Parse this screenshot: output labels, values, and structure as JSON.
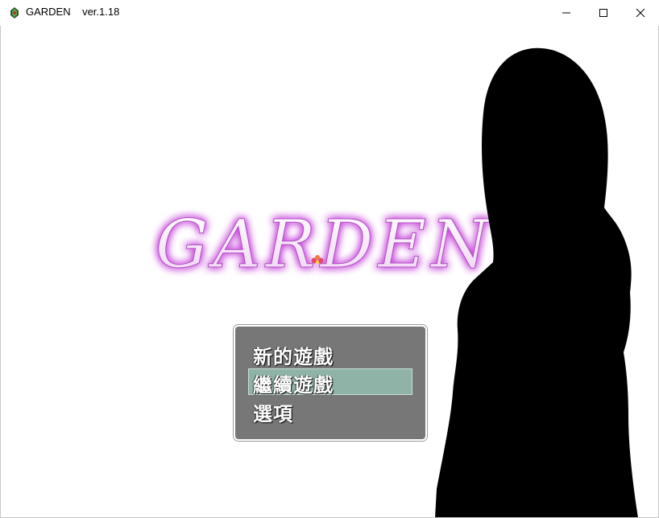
{
  "window": {
    "title": "GARDEN    ver.1.18",
    "controls": [
      "minimize",
      "maximize",
      "close"
    ]
  },
  "logo": {
    "text": "GARDEN",
    "glow_color": "#c43fd8"
  },
  "menu": {
    "items": [
      {
        "label": "新的遊戲"
      },
      {
        "label": "繼續遊戲",
        "selected": true
      },
      {
        "label": "選項"
      }
    ],
    "cursor_color": "#8fb3a7"
  },
  "colors": {
    "window_bg": "#5f5f5f",
    "background": "#ffffff",
    "silhouette": "#000000"
  }
}
